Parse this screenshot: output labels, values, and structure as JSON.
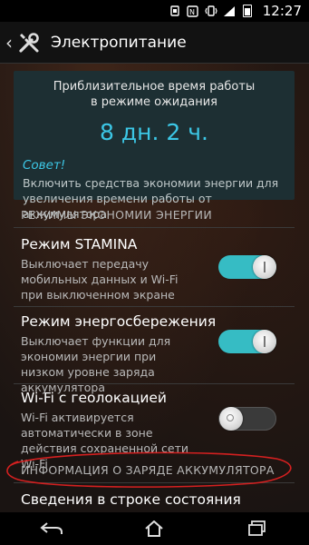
{
  "status_bar": {
    "time": "12:27",
    "icons": [
      "notification-icon",
      "nfc-icon",
      "vibrate-icon",
      "signal-icon",
      "battery-icon"
    ]
  },
  "action_bar": {
    "title": "Электропитание",
    "back_icon": "chevron-left-icon",
    "app_icon": "tools-icon"
  },
  "estimate_card": {
    "label": "Приблизительное время работы в режиме ожидания",
    "value": "8 дн. 2 ч.",
    "tip_title": "Совет!",
    "tip_text": "Включить средства экономии энергии для увеличения времени работы от аккумулятора"
  },
  "sections": {
    "modes_header": "РЕЖИМЫ ЭКОНОМИИ ЭНЕРГИИ",
    "battery_info_header": "ИНФОРМАЦИЯ О ЗАРЯДЕ АККУМУЛЯТОРА"
  },
  "settings": [
    {
      "title": "Режим STAMINA",
      "description": "Выключает передачу мобильных данных и Wi-Fi при выключенном экране",
      "enabled": true
    },
    {
      "title": "Режим энергосбережения",
      "description": "Выключает функции для экономии энергии при низком уровне заряда аккумулятора",
      "enabled": true
    },
    {
      "title": "Wi-Fi с геолокацией",
      "description": "Wi-Fi активируется автоматически в зоне действия сохраненной сети Wi-Fi",
      "enabled": false
    }
  ],
  "partial_item": {
    "title": "Сведения в строке состояния"
  },
  "colors": {
    "accent": "#3cc7e6",
    "toggle_on": "#36bcc4",
    "card_bg": "#1d2f33",
    "annotation": "#d42020"
  },
  "nav_bar": {
    "buttons": [
      "back-icon",
      "home-icon",
      "recent-apps-icon"
    ]
  }
}
